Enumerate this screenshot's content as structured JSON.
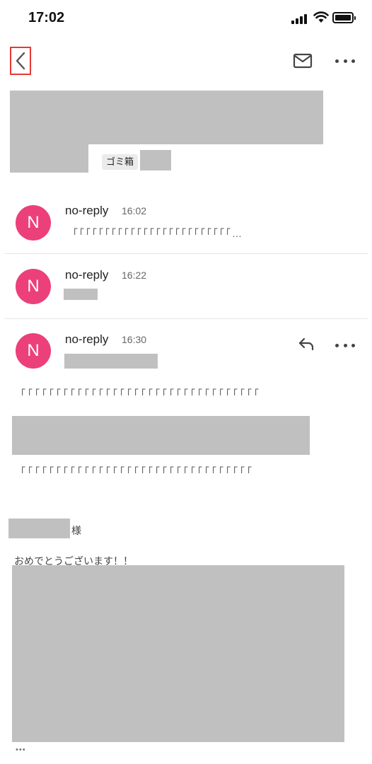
{
  "status_bar": {
    "time": "17:02"
  },
  "toolbar": {
    "back_icon": "chevron-left",
    "mail_icon": "envelope",
    "more_icon": "ellipsis"
  },
  "label": {
    "trash": "ゴミ箱"
  },
  "messages": [
    {
      "avatar_letter": "N",
      "sender": "no-reply",
      "time": "16:02",
      "snippet": "「「「「「「「「「「「「「「「「「「「「「「「「「…"
    },
    {
      "avatar_letter": "N",
      "sender": "no-reply",
      "time": "16:22"
    },
    {
      "avatar_letter": "N",
      "sender": "no-reply",
      "time": "16:30"
    }
  ],
  "expanded_message": {
    "paragraph1": "「「「「「「「「「「「「「「「「「「「「「「「「「「「「「「「「「「",
    "paragraph2": "「「「「「「「「「「「「「「「「「「「「「「「「「「「「「「「「「",
    "honorific": "様",
    "greeting": "おめでとうございます！！",
    "trimmed_indicator": "•••"
  },
  "colors": {
    "avatar": "#ec407a",
    "highlight_border": "#e53935",
    "redaction": "#c0c0c0"
  }
}
